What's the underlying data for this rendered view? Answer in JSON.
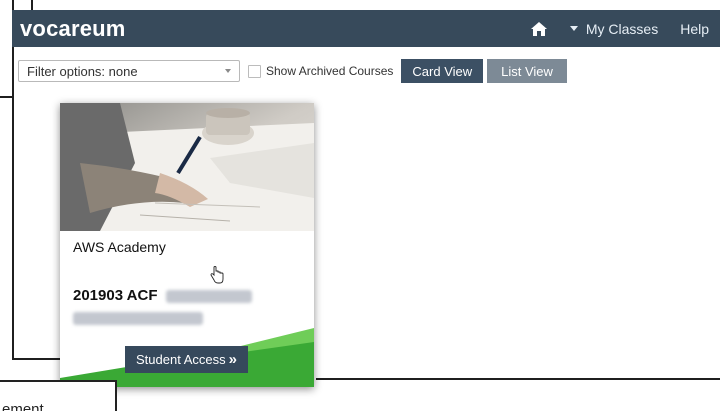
{
  "navbar": {
    "brand": "vocareum",
    "home_icon": "home-icon",
    "my_classes": "My Classes",
    "help": "Help"
  },
  "filters": {
    "select_value": "Filter options: none",
    "archived_label": "Show Archived Courses",
    "archived_checked": false,
    "card_view": "Card View",
    "list_view": "List View"
  },
  "card": {
    "provider": "AWS Academy",
    "title_prefix": "201903 ACF",
    "access_button": "Student Access",
    "access_arrow": "»"
  },
  "partial_window": {
    "text": "ement"
  },
  "colors": {
    "navbar": "#374a5b",
    "button_active": "#3c5064",
    "button_inactive": "#7d8a96",
    "card_green": "#3aa935"
  }
}
